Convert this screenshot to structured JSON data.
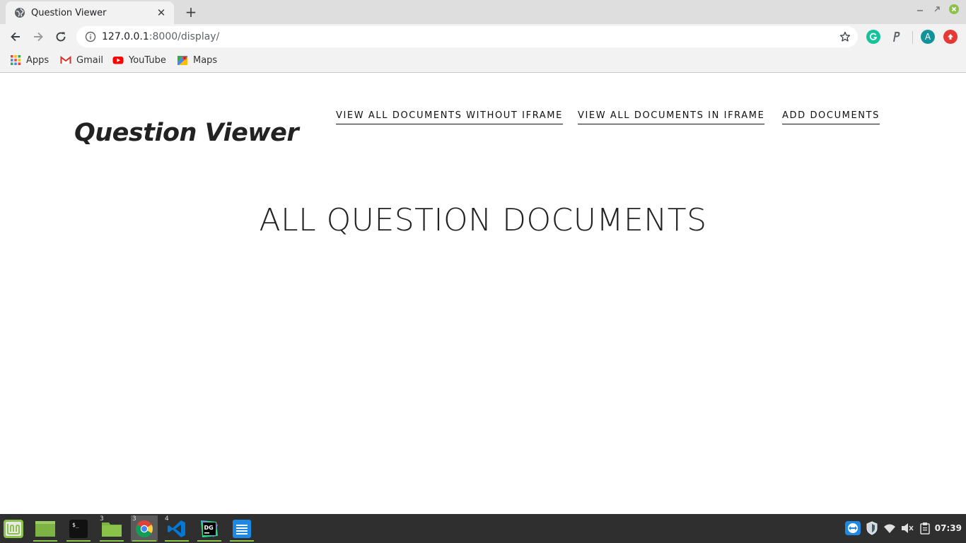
{
  "browser": {
    "tab_title": "Question Viewer",
    "new_tab_symbol": "+",
    "close_symbol": "✕",
    "url_host": "127.0.0.1",
    "url_rest": ":8000/display/",
    "profile_initial": "A",
    "extensions": [
      "grammarly-icon",
      "paypal-icon",
      "profile-avatar",
      "extension-update-icon"
    ]
  },
  "bookmarks": [
    {
      "label": "Apps",
      "icon": "apps-grid-icon"
    },
    {
      "label": "Gmail",
      "icon": "gmail-icon"
    },
    {
      "label": "YouTube",
      "icon": "youtube-icon"
    },
    {
      "label": "Maps",
      "icon": "maps-icon"
    }
  ],
  "site": {
    "title": "Question Viewer",
    "nav": [
      "VIEW ALL DOCUMENTS WITHOUT IFRAME",
      "VIEW ALL DOCUMENTS IN IFRAME",
      "ADD DOCUMENTS"
    ],
    "heading": "ALL QUESTION DOCUMENTS"
  },
  "taskbar": {
    "apps": [
      {
        "name": "mint-menu-icon",
        "count": ""
      },
      {
        "name": "files-icon",
        "count": ""
      },
      {
        "name": "terminal-icon",
        "count": ""
      },
      {
        "name": "folder-icon",
        "count": "3"
      },
      {
        "name": "chrome-icon",
        "count": "3"
      },
      {
        "name": "vscode-icon",
        "count": "4"
      },
      {
        "name": "datagrip-icon",
        "count": ""
      },
      {
        "name": "text-editor-icon",
        "count": ""
      }
    ],
    "clock": "07:39"
  },
  "colors": {
    "tabstrip": "#dedede",
    "toolbar": "#f2f2f2",
    "taskbar": "#2f2f2f",
    "mint_green": "#8bc34a"
  }
}
